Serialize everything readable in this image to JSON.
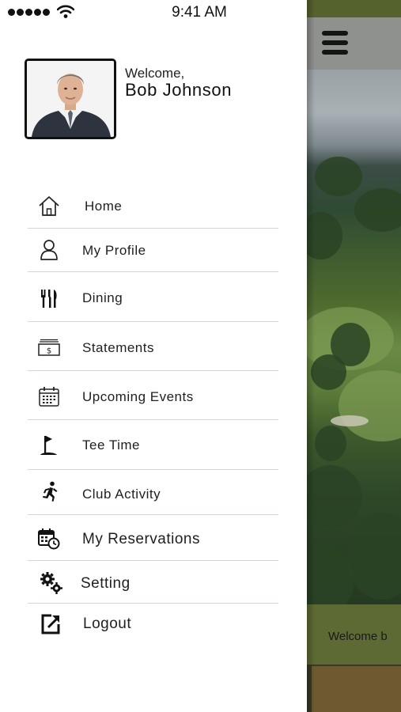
{
  "status_bar": {
    "time": "9:41 AM"
  },
  "drawer": {
    "welcome_label": "Welcome,",
    "user_name": "Bob Johnson",
    "menu": [
      {
        "label": "Home",
        "icon": "home-icon"
      },
      {
        "label": "My Profile",
        "icon": "person-icon"
      },
      {
        "label": "Dining",
        "icon": "fork-knife-icon"
      },
      {
        "label": "Statements",
        "icon": "money-statement-icon"
      },
      {
        "label": "Upcoming Events",
        "icon": "calendar-icon"
      },
      {
        "label": "Tee Time",
        "icon": "golf-flag-icon"
      },
      {
        "label": "Club Activity",
        "icon": "running-person-icon"
      },
      {
        "label": "My Reservations",
        "icon": "calendar-clock-icon"
      },
      {
        "label": "Setting",
        "icon": "gears-icon"
      },
      {
        "label": "Logout",
        "icon": "logout-icon"
      }
    ]
  },
  "background_app": {
    "welcome_text": "Welcome b"
  },
  "colors": {
    "divider": "#cfd8d6",
    "app_green": "#5d6a33",
    "header_grey": "#8f918e"
  }
}
